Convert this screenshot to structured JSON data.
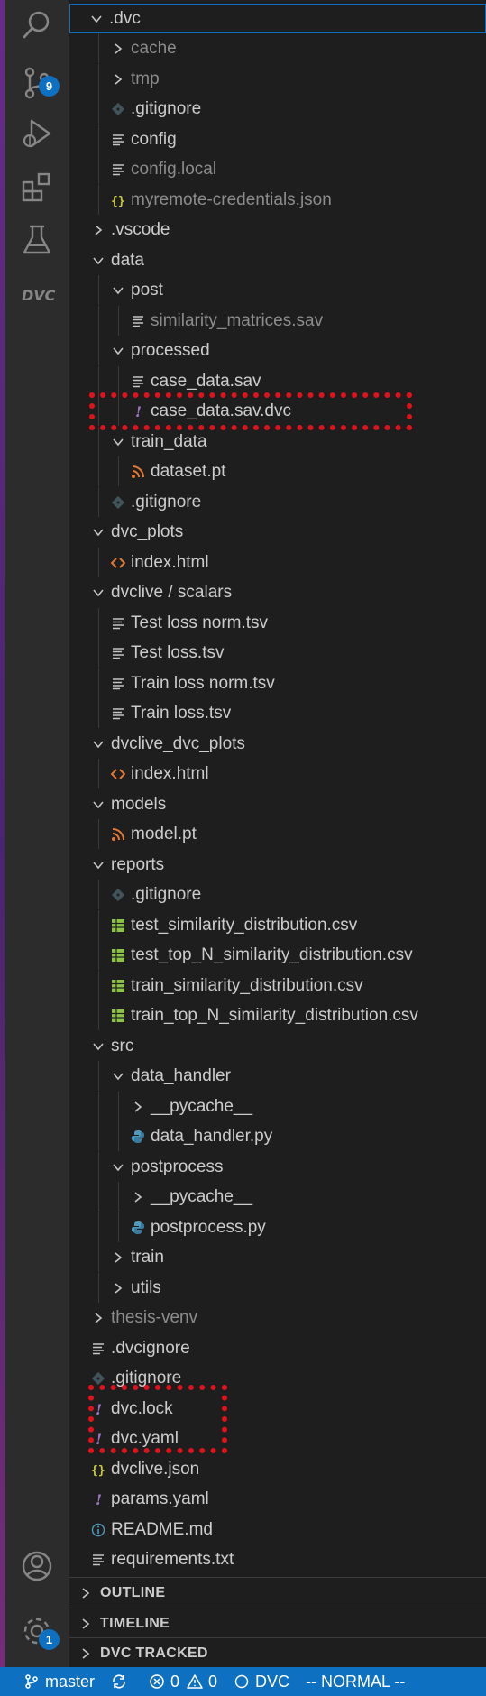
{
  "activity_bar": {
    "source_control_badge": "9",
    "settings_badge": "1",
    "dvc_logo_text": "DVC"
  },
  "explorer": {
    "tree": [
      {
        "label": "cache",
        "type": "folder",
        "expanded": false,
        "indent": 1,
        "dim": true
      },
      {
        "label": "tmp",
        "type": "folder",
        "expanded": false,
        "indent": 1,
        "dim": true
      },
      {
        "label": ".gitignore",
        "type": "file",
        "icon": "git-icon",
        "indent": 1
      },
      {
        "label": "config",
        "type": "file",
        "icon": "text-file-icon",
        "indent": 1
      },
      {
        "label": "config.local",
        "type": "file",
        "icon": "text-file-icon",
        "indent": 1,
        "dim": true
      },
      {
        "label": "myremote-credentials.json",
        "type": "file",
        "icon": "json-icon",
        "indent": 1,
        "dim": true
      },
      {
        "label": ".vscode",
        "type": "folder",
        "expanded": false,
        "indent": 0
      },
      {
        "label": "data",
        "type": "folder",
        "expanded": true,
        "indent": 0
      },
      {
        "label": "post",
        "type": "folder",
        "expanded": true,
        "indent": 1
      },
      {
        "label": "similarity_matrices.sav",
        "type": "file",
        "icon": "text-file-icon",
        "indent": 2,
        "dim": true
      },
      {
        "label": "processed",
        "type": "folder",
        "expanded": true,
        "indent": 1
      },
      {
        "label": "case_data.sav",
        "type": "file",
        "icon": "text-file-icon",
        "indent": 2
      },
      {
        "label": "case_data.sav.dvc",
        "type": "file",
        "icon": "exclaim-icon",
        "indent": 2
      },
      {
        "label": "train_data",
        "type": "folder",
        "expanded": true,
        "indent": 1
      },
      {
        "label": "dataset.pt",
        "type": "file",
        "icon": "rss-icon",
        "indent": 2
      },
      {
        "label": ".gitignore",
        "type": "file",
        "icon": "git-icon",
        "indent": 1
      },
      {
        "label": "dvc_plots",
        "type": "folder",
        "expanded": true,
        "indent": 0
      },
      {
        "label": "index.html",
        "type": "file",
        "icon": "html-icon",
        "indent": 1
      },
      {
        "label": "dvclive / scalars",
        "type": "folder",
        "expanded": true,
        "indent": 0
      },
      {
        "label": "Test loss norm.tsv",
        "type": "file",
        "icon": "text-file-icon",
        "indent": 1
      },
      {
        "label": "Test loss.tsv",
        "type": "file",
        "icon": "text-file-icon",
        "indent": 1
      },
      {
        "label": "Train loss norm.tsv",
        "type": "file",
        "icon": "text-file-icon",
        "indent": 1
      },
      {
        "label": "Train loss.tsv",
        "type": "file",
        "icon": "text-file-icon",
        "indent": 1
      },
      {
        "label": "dvclive_dvc_plots",
        "type": "folder",
        "expanded": true,
        "indent": 0
      },
      {
        "label": "index.html",
        "type": "file",
        "icon": "html-icon",
        "indent": 1
      },
      {
        "label": "models",
        "type": "folder",
        "expanded": true,
        "indent": 0
      },
      {
        "label": "model.pt",
        "type": "file",
        "icon": "rss-icon",
        "indent": 1
      },
      {
        "label": "reports",
        "type": "folder",
        "expanded": true,
        "indent": 0
      },
      {
        "label": ".gitignore",
        "type": "file",
        "icon": "git-icon",
        "indent": 1
      },
      {
        "label": "test_similarity_distribution.csv",
        "type": "file",
        "icon": "csv-icon",
        "indent": 1
      },
      {
        "label": "test_top_N_similarity_distribution.csv",
        "type": "file",
        "icon": "csv-icon",
        "indent": 1
      },
      {
        "label": "train_similarity_distribution.csv",
        "type": "file",
        "icon": "csv-icon",
        "indent": 1
      },
      {
        "label": "train_top_N_similarity_distribution.csv",
        "type": "file",
        "icon": "csv-icon",
        "indent": 1
      },
      {
        "label": "src",
        "type": "folder",
        "expanded": true,
        "indent": 0
      },
      {
        "label": "data_handler",
        "type": "folder",
        "expanded": true,
        "indent": 1
      },
      {
        "label": "__pycache__",
        "type": "folder",
        "expanded": false,
        "indent": 2
      },
      {
        "label": "data_handler.py",
        "type": "file",
        "icon": "python-icon",
        "indent": 2
      },
      {
        "label": "postprocess",
        "type": "folder",
        "expanded": true,
        "indent": 1
      },
      {
        "label": "__pycache__",
        "type": "folder",
        "expanded": false,
        "indent": 2
      },
      {
        "label": "postprocess.py",
        "type": "file",
        "icon": "python-icon",
        "indent": 2
      },
      {
        "label": "train",
        "type": "folder",
        "expanded": false,
        "indent": 1
      },
      {
        "label": "utils",
        "type": "folder",
        "expanded": false,
        "indent": 1
      },
      {
        "label": "thesis-venv",
        "type": "folder",
        "expanded": false,
        "indent": 0,
        "dim": true
      },
      {
        "label": ".dvcignore",
        "type": "file",
        "icon": "text-file-icon",
        "indent": 0
      },
      {
        "label": ".gitignore",
        "type": "file",
        "icon": "git-icon",
        "indent": 0
      },
      {
        "label": "dvc.lock",
        "type": "file",
        "icon": "exclaim-icon",
        "indent": 0
      },
      {
        "label": "dvc.yaml",
        "type": "file",
        "icon": "exclaim-icon",
        "indent": 0
      },
      {
        "label": "dvclive.json",
        "type": "file",
        "icon": "json-icon",
        "indent": 0
      },
      {
        "label": "params.yaml",
        "type": "file",
        "icon": "exclaim-icon",
        "indent": 0
      },
      {
        "label": "README.md",
        "type": "file",
        "icon": "info-icon",
        "indent": 0
      },
      {
        "label": "requirements.txt",
        "type": "file",
        "icon": "text-file-icon",
        "indent": 0
      }
    ],
    "root_folder": {
      "label": ".dvc",
      "expanded": true
    },
    "sections": {
      "outline": "OUTLINE",
      "timeline": "TIMELINE",
      "dvc_tracked": "DVC TRACKED"
    }
  },
  "status_bar": {
    "branch": "master",
    "errors": "0",
    "warnings": "0",
    "dvc": "DVC",
    "mode": "-- NORMAL --"
  },
  "colors": {
    "accent": "#0e70c0",
    "highlight_box": "#e0121b",
    "exclaim": "#a074c4",
    "rss": "#e37933",
    "csv": "#8dc149",
    "python": "#519aba",
    "json": "#cbcb41"
  }
}
